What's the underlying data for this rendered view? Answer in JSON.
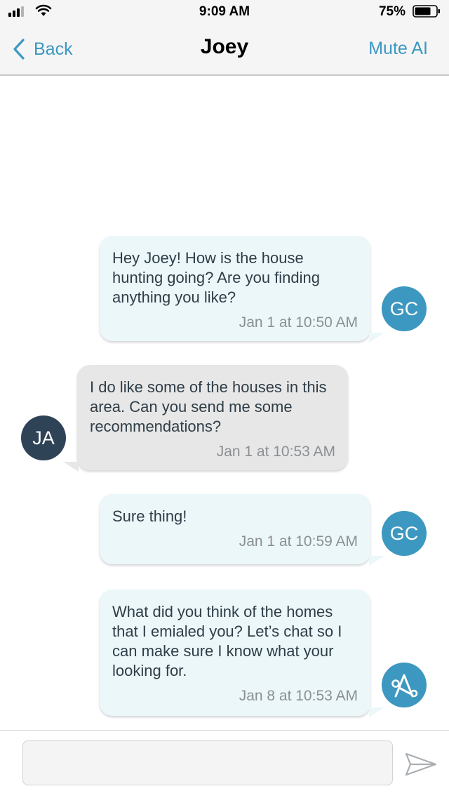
{
  "status_bar": {
    "time": "9:09 AM",
    "battery": "75%"
  },
  "nav": {
    "back_label": "Back",
    "title": "Joey",
    "mute_label": "Mute AI"
  },
  "messages": [
    {
      "text": "Hey Joey! How is the house\nhunting going? Are you finding\nanything you like?",
      "time": "Jan 1 at 10:50 AM",
      "avatar": "GC"
    },
    {
      "text": "I do like some of the houses in this\narea. Can you send me some\nrecommendations?",
      "time": "Jan 1 at 10:53 AM",
      "avatar": "JA"
    },
    {
      "text": "Sure thing!",
      "time": "Jan 1 at 10:59 AM",
      "avatar": "GC"
    },
    {
      "text": "What did you think of the homes\nthat I emialed you? Let’s chat so I\ncan make sure I know what your\nlooking for.",
      "time": "Jan 8 at 10:53 AM",
      "avatar": "ai-bot-icon"
    }
  ],
  "composer": {
    "value": "",
    "placeholder": ""
  },
  "colors": {
    "accent": "#3c98c0",
    "outgoing_bubble": "#ecf7fa",
    "incoming_bubble": "#e7e7e7",
    "contact_avatar": "#2f4357"
  }
}
